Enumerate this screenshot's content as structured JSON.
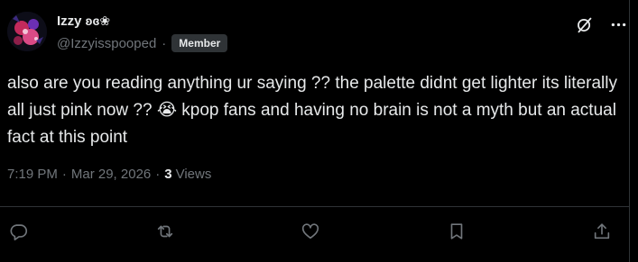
{
  "user": {
    "display_name": "Izzy",
    "name_emoji": "ʚɞ❀",
    "handle": "@Izzyisspooped",
    "separator": "·",
    "badge": "Member"
  },
  "header_icons": [
    "grok-icon",
    "more-icon"
  ],
  "tweet": {
    "text": "also are you reading anything ur saying ?? the palette didnt get lighter its literally all just pink now ?? 😭 kpop fans and having no brain is not a myth but an actual fact at this point"
  },
  "meta": {
    "time": "7:19 PM",
    "separator": "·",
    "date": "Mar 29, 2026",
    "views_count": "3",
    "views_label": "Views"
  },
  "actions": [
    "reply-icon",
    "repost-icon",
    "like-icon",
    "bookmark-icon",
    "share-icon"
  ],
  "colors": {
    "background": "#000000",
    "text": "#e7e9ea",
    "muted": "#71767b",
    "border": "#2f3336"
  }
}
